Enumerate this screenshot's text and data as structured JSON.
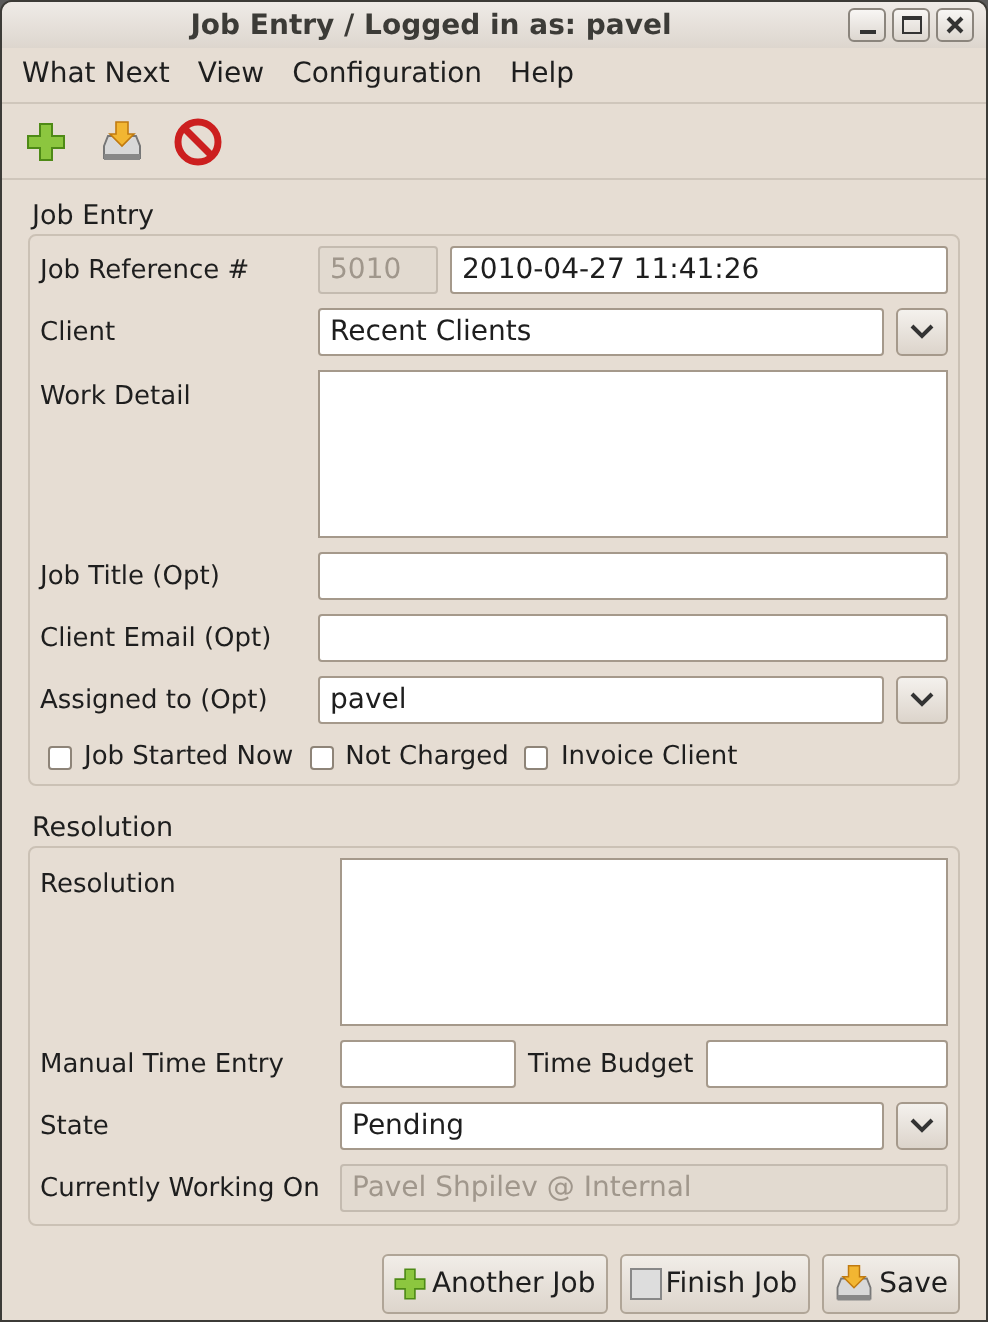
{
  "window": {
    "title": "Job Entry / Logged in as: pavel"
  },
  "menu": [
    "What Next",
    "View",
    "Configuration",
    "Help"
  ],
  "toolbar": [
    {
      "kind": "add"
    },
    {
      "kind": "save"
    },
    {
      "kind": "cancel"
    }
  ],
  "job_entry": {
    "title": "Job Entry",
    "rows": [
      {
        "kind": "ref",
        "label": "Job Reference #",
        "value": "5010",
        "date": "2010-04-27 11:41:26"
      },
      {
        "kind": "combo",
        "label": "Client",
        "value": "Recent Clients"
      },
      {
        "kind": "textarea",
        "label": "Work Detail"
      },
      {
        "kind": "entry",
        "label": "Job Title (Opt)"
      },
      {
        "kind": "entry",
        "label": "Client Email (Opt)"
      },
      {
        "kind": "combo",
        "label": "Assigned to (Opt)",
        "value": "pavel"
      }
    ],
    "checks": [
      {
        "label": "Job Started Now",
        "checked": false
      },
      {
        "label": "Not Charged",
        "checked": false
      },
      {
        "label": "Invoice Client",
        "checked": false
      }
    ]
  },
  "resolution": {
    "title": "Resolution",
    "rows": [
      {
        "kind": "textarea",
        "label": "Resolution"
      },
      {
        "kind": "pair",
        "label": "Manual Time Entry",
        "label_2": "Time Budget"
      },
      {
        "kind": "combo",
        "label": "State",
        "value": "Pending"
      },
      {
        "kind": "disabled",
        "label": "Currently Working On",
        "value": "Pavel Shpilev @ Internal"
      }
    ]
  },
  "buttons": [
    {
      "kind": "add",
      "label": "Another Job"
    },
    {
      "kind": "finish",
      "label": "Finish Job"
    },
    {
      "kind": "save",
      "label": "Save"
    }
  ]
}
